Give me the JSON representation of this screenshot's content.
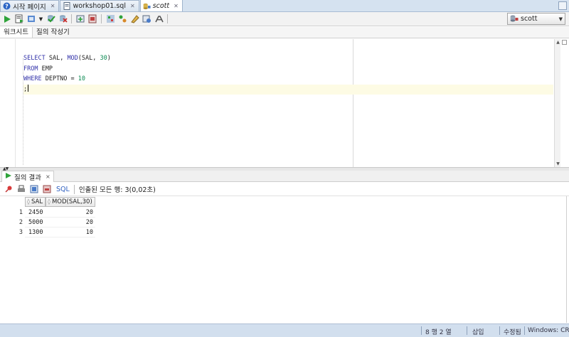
{
  "doc_tabs": [
    {
      "label": "시작 페이지",
      "icon": "help-icon",
      "active": false
    },
    {
      "label": "workshop01.sql",
      "icon": "sql-file-icon",
      "active": false
    },
    {
      "label": "scott",
      "icon": "db-connection-icon",
      "active": true
    }
  ],
  "toolbar": {
    "connection": "scott"
  },
  "sub_tabs": [
    "워크시트",
    "질의 작성기"
  ],
  "editor": {
    "lines": [
      {
        "parts": [
          {
            "t": "SELECT",
            "c": "kw"
          },
          {
            "t": " SAL, ",
            "c": ""
          },
          {
            "t": "MOD",
            "c": "fn"
          },
          {
            "t": "(SAL, ",
            "c": ""
          },
          {
            "t": "30",
            "c": "num"
          },
          {
            "t": ")",
            "c": ""
          }
        ]
      },
      {
        "parts": [
          {
            "t": "FROM",
            "c": "kw"
          },
          {
            "t": " EMP",
            "c": ""
          }
        ]
      },
      {
        "parts": [
          {
            "t": "WHERE",
            "c": "kw"
          },
          {
            "t": " DEPTNO = ",
            "c": ""
          },
          {
            "t": "10",
            "c": "num"
          }
        ]
      },
      {
        "parts": [
          {
            "t": ";",
            "c": ""
          }
        ],
        "current": true
      }
    ]
  },
  "results": {
    "tab_label": "질의 결과",
    "sql_label": "SQL",
    "fetch_status": "인출된 모든 행: 3(0,02초)",
    "columns": [
      "SAL",
      "MOD(SAL,30)"
    ],
    "rows": [
      {
        "num": "1",
        "sal": "2450",
        "mod": "20"
      },
      {
        "num": "2",
        "sal": "5000",
        "mod": "20"
      },
      {
        "num": "3",
        "sal": "1300",
        "mod": "10"
      }
    ]
  },
  "status": {
    "position": "8 행 2 열",
    "insert_mode": "삽입",
    "modified": "수정됨",
    "line_endings": "Windows: CR"
  }
}
